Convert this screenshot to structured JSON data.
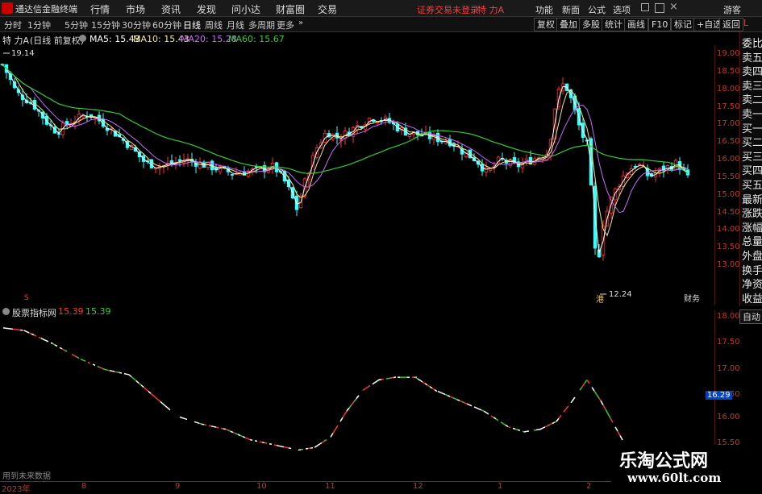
{
  "menubar": {
    "app_name": "通达信金融终端",
    "items": [
      "行情",
      "市场",
      "资讯",
      "发现",
      "问小达",
      "财富圈",
      "交易"
    ],
    "login_notice": "证券交易未登录",
    "stock_name": "特 力A",
    "right_items": [
      "功能",
      "新面",
      "公式",
      "选项"
    ],
    "guest": "游客"
  },
  "toolbar": {
    "periods": [
      "分时",
      "1分钟",
      "5分钟",
      "15分钟",
      "30分钟",
      "60分钟",
      "日线",
      "周线",
      "月线",
      "多周期",
      "更多"
    ],
    "active_period": "日线",
    "right_buttons": [
      "复权",
      "叠加",
      "多股",
      "统计",
      "画线",
      "F10",
      "标记",
      "+自选",
      "返回"
    ]
  },
  "legend": {
    "stock_label": "特 力A",
    "adjust": "(日线 前复权)",
    "ma5": "MA5: 15.43",
    "ma10": "MA10: 15.43",
    "ma20": "MA20: 15.28",
    "ma60": "MA60: 15.67",
    "colors": {
      "ma5": "#ffffff",
      "ma10": "#f0e68c",
      "ma20": "#cc66ff",
      "ma60": "#33cc33",
      "up": "#ff3333",
      "down": "#33ffff"
    }
  },
  "main_chart": {
    "y_ticks": [
      "19.00",
      "18.50",
      "18.00",
      "17.50",
      "17.00",
      "16.50",
      "16.00",
      "15.50",
      "15.00",
      "14.50",
      "14.00",
      "13.50",
      "13.00"
    ],
    "high_label": "19.14",
    "low_label": "12.24",
    "event_label": "财务",
    "marker_s": "S",
    "marker_low": "港"
  },
  "sidebar": {
    "items": [
      "委比",
      "卖五",
      "卖四",
      "卖三",
      "卖二",
      "卖一",
      "买一",
      "买二",
      "买三",
      "买四",
      "买五",
      "最新",
      "涨跌",
      "涨幅",
      "总量",
      "外盘",
      "换手",
      "净资",
      "收益"
    ],
    "top_label": "L"
  },
  "sub_chart": {
    "title": "股票指标网",
    "value1": "15.39",
    "value2": "15.39",
    "y_ticks": [
      "18.00",
      "17.50",
      "17.00",
      "16.50",
      "16.00",
      "15.50"
    ],
    "highlight": "16.29",
    "footer_note": "用到未来数据",
    "auto_button": "自动"
  },
  "xaxis": {
    "labels": [
      "2023年",
      "8",
      "9",
      "10",
      "11",
      "12",
      "1",
      "2"
    ]
  },
  "watermark": {
    "line1": "乐淘公式网",
    "line2": "www.60lt.com"
  }
}
